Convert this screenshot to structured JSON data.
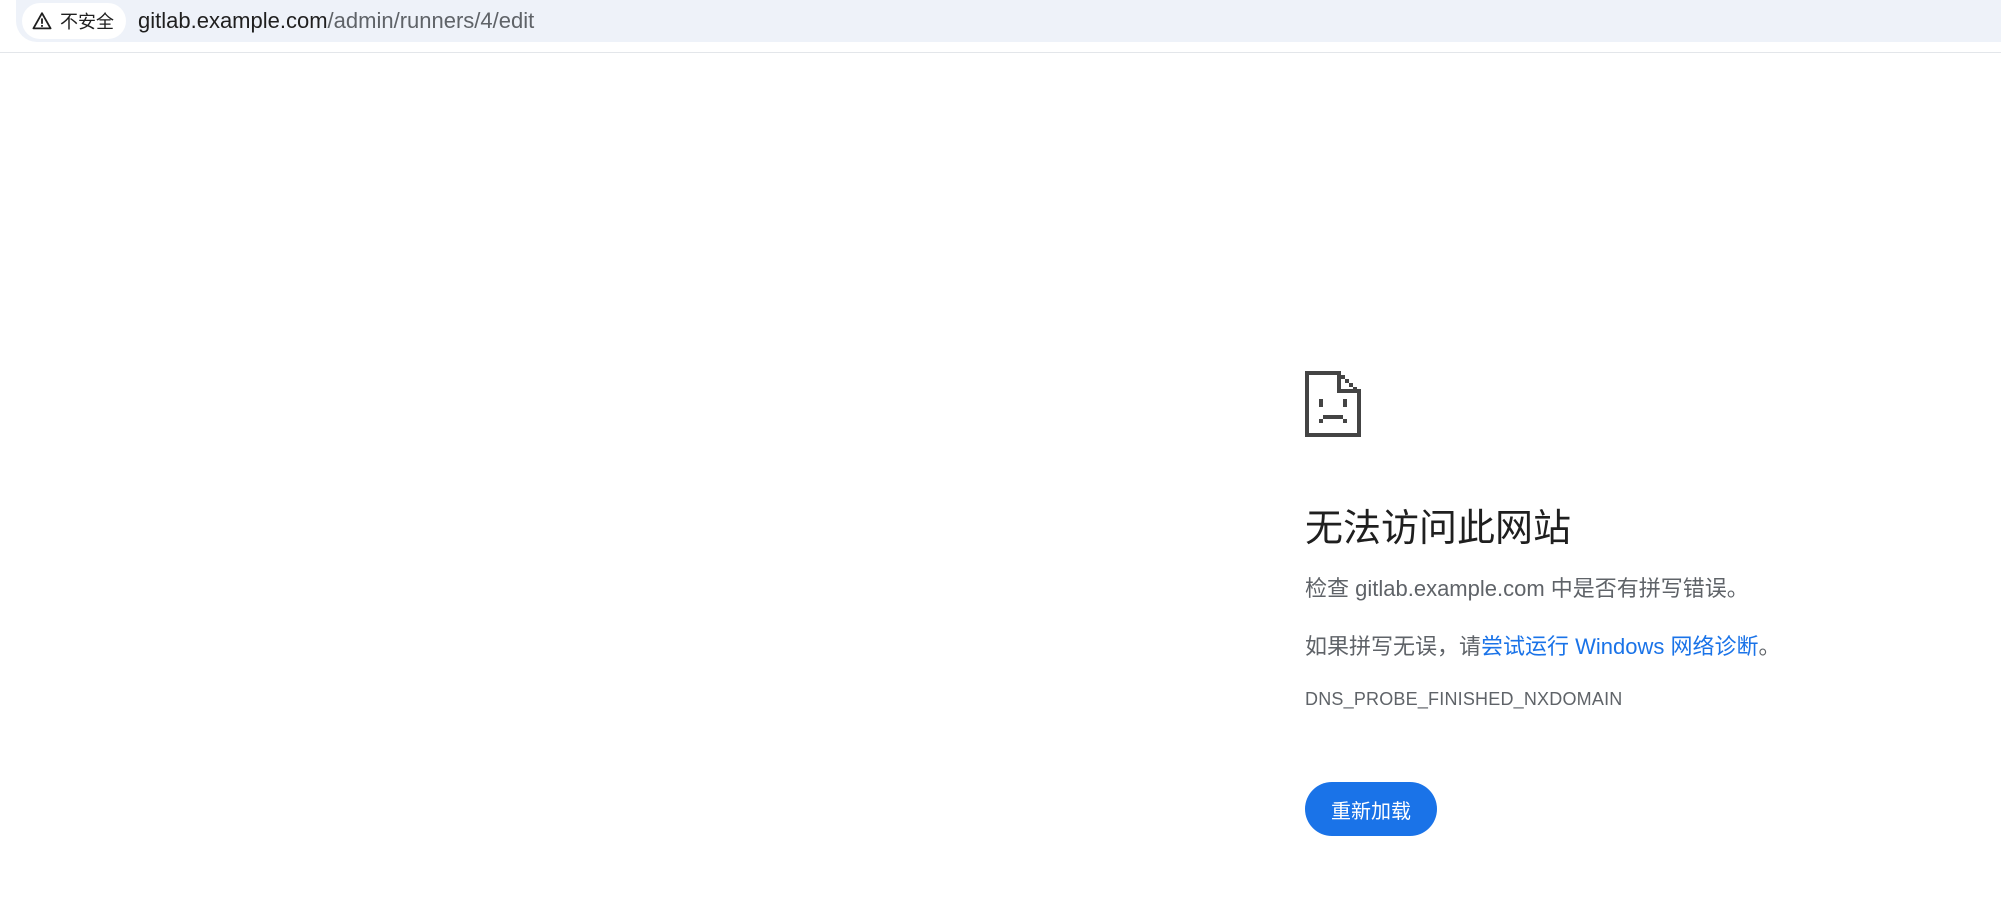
{
  "browser": {
    "security_chip": {
      "label": "不安全",
      "icon": "warning-triangle-icon"
    },
    "url": {
      "host": "gitlab.example.com",
      "path": "/admin/runners/4/edit"
    }
  },
  "error": {
    "icon": "sad-page-icon",
    "heading": "无法访问此网站",
    "check_prefix": "检查 ",
    "check_host": "gitlab.example.com",
    "check_suffix": " 中是否有拼写错误。",
    "suggest_prefix": "如果拼写无误，请",
    "suggest_link": "尝试运行 Windows 网络诊断",
    "suggest_suffix": "。",
    "code": "DNS_PROBE_FINISHED_NXDOMAIN",
    "reload_label": "重新加载"
  },
  "colors": {
    "accent": "#1a73e8",
    "text_primary": "#1f1f1f",
    "text_secondary": "#5f6368",
    "omnibox_bg": "#eef2f9"
  }
}
